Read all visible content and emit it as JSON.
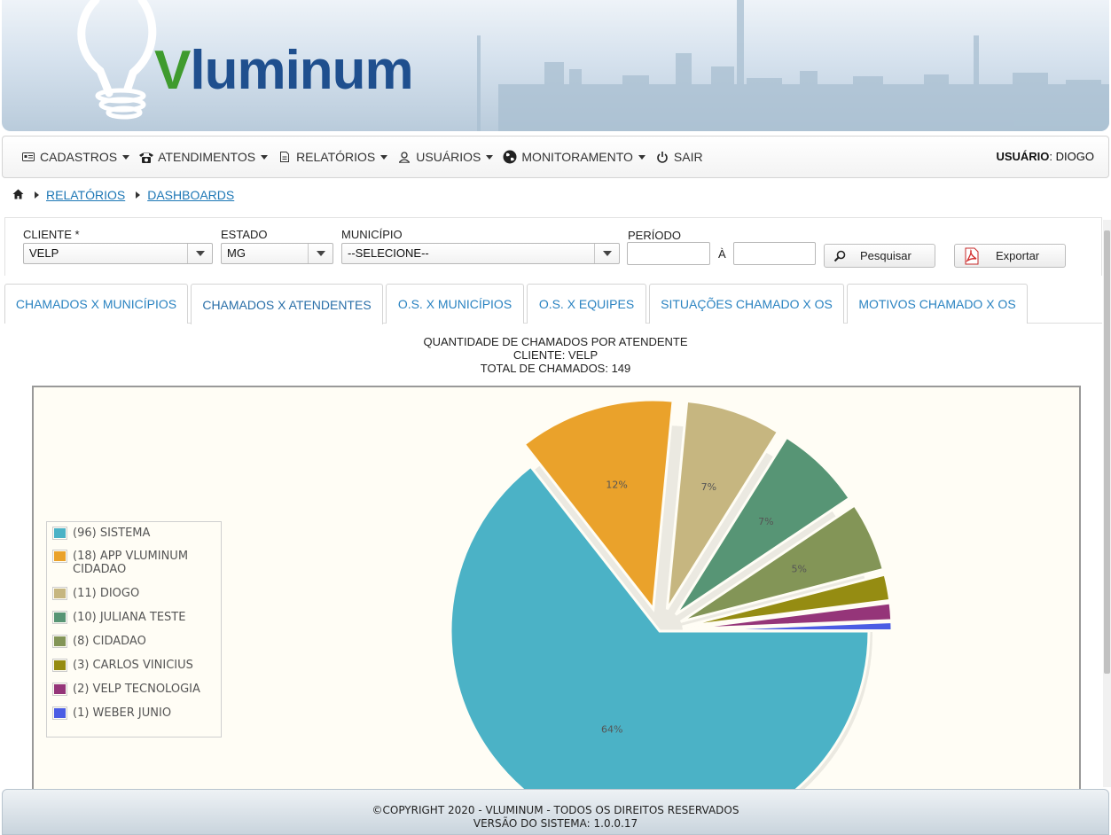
{
  "banner": {
    "logo_v": "V",
    "logo_rest": "luminum"
  },
  "menu": {
    "items": [
      {
        "label": "CADASTROS",
        "icon": "id-card-icon",
        "dropdown": true
      },
      {
        "label": "ATENDIMENTOS",
        "icon": "telephone-icon",
        "dropdown": true
      },
      {
        "label": "RELATÓRIOS",
        "icon": "document-icon",
        "dropdown": true
      },
      {
        "label": "USUÁRIOS",
        "icon": "user-icon",
        "dropdown": true
      },
      {
        "label": "MONITORAMENTO",
        "icon": "globe-icon",
        "dropdown": true
      },
      {
        "label": "SAIR",
        "icon": "power-icon",
        "dropdown": false
      }
    ],
    "user_label": "USUÁRIO",
    "user_sep": ":",
    "user_name": "DIOGO"
  },
  "breadcrumb": {
    "items": [
      "RELATÓRIOS",
      "DASHBOARDS"
    ]
  },
  "filters": {
    "cliente_label": "CLIENTE *",
    "cliente_value": "VELP",
    "estado_label": "ESTADO",
    "estado_value": "MG",
    "municipio_label": "MUNICÍPIO",
    "municipio_value": "--SELECIONE--",
    "periodo_label": "PERÍODO",
    "periodo_sep": "À",
    "periodo_start": "",
    "periodo_end": "",
    "search_label": "Pesquisar",
    "export_label": "Exportar"
  },
  "tabs": [
    {
      "label": "CHAMADOS X MUNICÍPIOS",
      "active": false
    },
    {
      "label": "CHAMADOS X ATENDENTES",
      "active": true
    },
    {
      "label": "O.S. X MUNICÍPIOS",
      "active": false
    },
    {
      "label": "O.S. X EQUIPES",
      "active": false
    },
    {
      "label": "SITUAÇÕES CHAMADO X OS",
      "active": false
    },
    {
      "label": "MOTIVOS CHAMADO X OS",
      "active": false
    }
  ],
  "chart_data": {
    "type": "pie",
    "title": "QUANTIDADE DE CHAMADOS POR ATENDENTE",
    "subtitle": "CLIENTE: VELP",
    "total_label": "TOTAL DE CHAMADOS: 149",
    "legend_position": "left",
    "slices": [
      {
        "label": "(96) SISTEMA",
        "value": 96,
        "pct_label": "64%",
        "color": "#4bb2c6"
      },
      {
        "label": "(18) APP VLUMINUM CIDADAO",
        "value": 18,
        "pct_label": "12%",
        "color": "#eaa22b"
      },
      {
        "label": "(11) DIOGO",
        "value": 11,
        "pct_label": "7%",
        "color": "#c6b680"
      },
      {
        "label": "(10) JULIANA TESTE",
        "value": 10,
        "pct_label": "7%",
        "color": "#579575"
      },
      {
        "label": "(8) CIDADAO",
        "value": 8,
        "pct_label": "5%",
        "color": "#839557"
      },
      {
        "label": "(3) CARLOS VINICIUS",
        "value": 3,
        "pct_label": "",
        "color": "#958c12"
      },
      {
        "label": "(2) VELP TECNOLOGIA",
        "value": 2,
        "pct_label": "",
        "color": "#953579"
      },
      {
        "label": "(1) WEBER JUNIO",
        "value": 1,
        "pct_label": "",
        "color": "#4b5de4"
      }
    ]
  },
  "footer": {
    "copyright": "©COPYRIGHT 2020 - VLUMINUM - TODOS OS DIREITOS RESERVADOS",
    "version": "VERSÃO DO SISTEMA: 1.0.0.17"
  }
}
